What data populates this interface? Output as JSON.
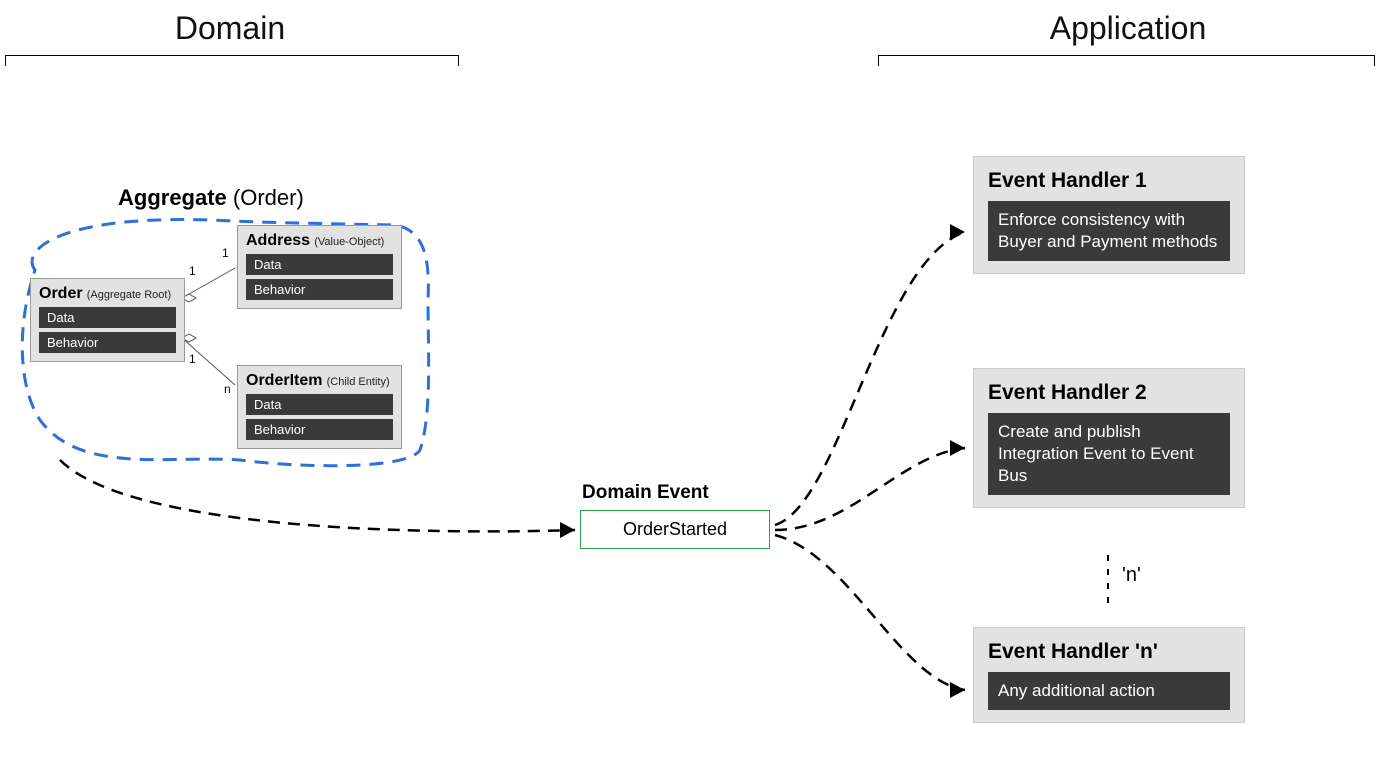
{
  "sections": {
    "domain": "Domain",
    "application": "Application"
  },
  "aggregate": {
    "label_bold": "Aggregate",
    "label_paren": "(Order)",
    "order": {
      "name": "Order",
      "role": "(Aggregate Root)",
      "data": "Data",
      "behavior": "Behavior"
    },
    "address": {
      "name": "Address",
      "role": "(Value-Object)",
      "data": "Data",
      "behavior": "Behavior"
    },
    "orderitem": {
      "name": "OrderItem",
      "role": "(Child Entity)",
      "data": "Data",
      "behavior": "Behavior"
    },
    "card_order_addr_a": "1",
    "card_order_addr_b": "1",
    "card_order_item_a": "1",
    "card_order_item_n": "n"
  },
  "domain_event": {
    "label": "Domain Event",
    "name": "OrderStarted"
  },
  "handlers": {
    "h1": {
      "title": "Event Handler 1",
      "desc": "Enforce consistency with Buyer and Payment methods"
    },
    "h2": {
      "title": "Event Handler 2",
      "desc": "Create and publish Integration Event to Event Bus"
    },
    "hn": {
      "title": "Event Handler 'n'",
      "desc": "Any additional action"
    },
    "n_label": "'n'"
  }
}
